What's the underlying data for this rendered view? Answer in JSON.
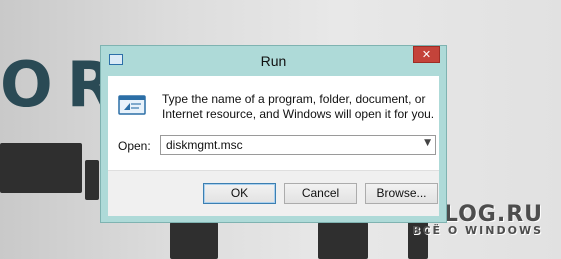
{
  "background": {
    "poster_text": "OR",
    "watermark_title": "WINBLOG.RU",
    "watermark_subtitle": "ВСЁ О WINDOWS"
  },
  "dialog": {
    "title": "Run",
    "close_glyph": "✕",
    "title_icon": "run-dialog-icon",
    "main_icon": "run-program-icon",
    "description": "Type the name of a program, folder, document, or Internet resource, and Windows will open it for you.",
    "open_label": "Open:",
    "open_value": "diskmgmt.msc",
    "dropdown_icon": "chevron-down-icon",
    "buttons": {
      "ok": "OK",
      "cancel": "Cancel",
      "browse": "Browse..."
    }
  },
  "colors": {
    "title_bar": "#aedad8",
    "close_button": "#c4433a",
    "default_button_border": "#3c7fb1"
  }
}
